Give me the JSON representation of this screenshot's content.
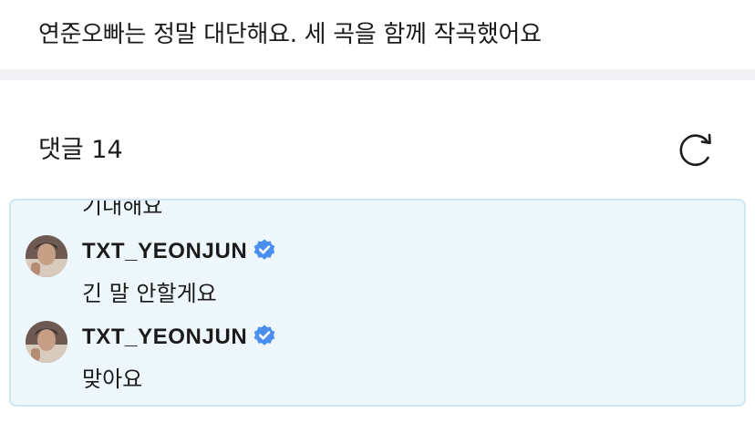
{
  "post": {
    "text": "연준오빠는 정말 대단해요. 세 곡을 함께 작곡했어요"
  },
  "comments": {
    "header": "댓글 14",
    "refresh_icon": "refresh-icon",
    "partial_text": "기대해요",
    "replies": [
      {
        "author": "TXT_YEONJUN",
        "verified": true,
        "text": "긴 말 안할게요"
      },
      {
        "author": "TXT_YEONJUN",
        "verified": true,
        "text": "맞아요"
      }
    ]
  },
  "colors": {
    "thread_bg": "#eef7fc",
    "thread_border": "#cfe5ef",
    "verified_badge": "#4a8ff0",
    "band": "#f2f2f4"
  }
}
